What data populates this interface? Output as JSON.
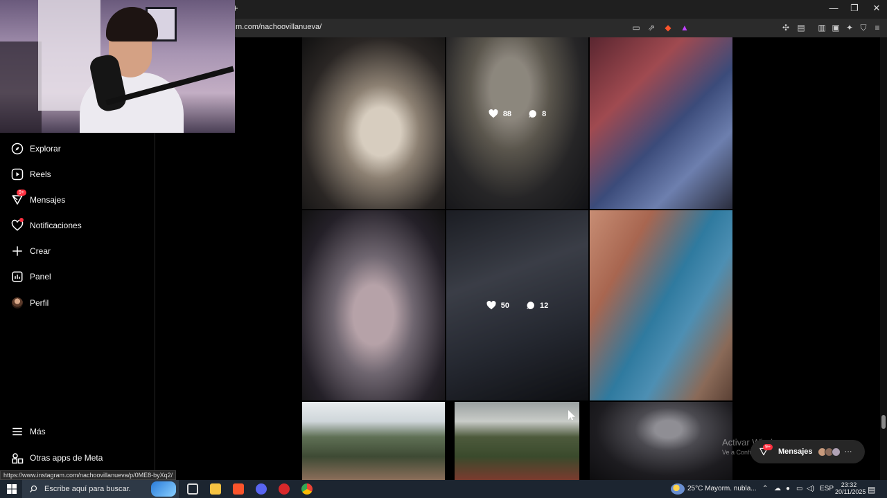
{
  "browser": {
    "url": "m.com/nachoovillanueva/",
    "new_tab": "+",
    "status_url": "https://www.instagram.com/nachoovillanueva/p/0ME8-byXq2/",
    "window_controls": [
      "—",
      "❐",
      "✕"
    ]
  },
  "sidebar": {
    "items": [
      {
        "label": "Explorar",
        "icon": "compass-icon"
      },
      {
        "label": "Reels",
        "icon": "reels-icon"
      },
      {
        "label": "Mensajes",
        "icon": "messenger-icon",
        "badge": "9+"
      },
      {
        "label": "Notificaciones",
        "icon": "heart-icon"
      },
      {
        "label": "Crear",
        "icon": "plus-icon"
      },
      {
        "label": "Panel",
        "icon": "chart-icon"
      },
      {
        "label": "Perfil",
        "icon": "avatar"
      }
    ],
    "bottom": [
      {
        "label": "Más",
        "icon": "hamburger-icon"
      },
      {
        "label": "Otras apps de Meta",
        "icon": "apps-icon"
      }
    ]
  },
  "grid": {
    "posts": [
      {
        "likes": "",
        "comments": ""
      },
      {
        "likes": "88",
        "comments": "8"
      },
      {
        "likes": "",
        "comments": ""
      },
      {
        "likes": "",
        "comments": ""
      },
      {
        "likes": "50",
        "comments": "12"
      },
      {
        "likes": "",
        "comments": ""
      },
      {
        "likes": "",
        "comments": ""
      },
      {
        "likes": "",
        "comments": ""
      },
      {
        "likes": "",
        "comments": ""
      }
    ]
  },
  "watermark": {
    "title": "Activar Windows",
    "subtitle": "Ve a Configuración para activar Windows."
  },
  "messages_pill": {
    "label": "Mensajes",
    "badge": "9+"
  },
  "taskbar": {
    "search_placeholder": "Escribe aquí para buscar.",
    "weather": "25°C  Mayorm. nubla...",
    "language": "ESP",
    "time": "23:32",
    "date": "20/11/2025"
  },
  "colors": {
    "accent_red": "#ff3040",
    "taskbar": "#1c2530",
    "background": "#000000"
  }
}
